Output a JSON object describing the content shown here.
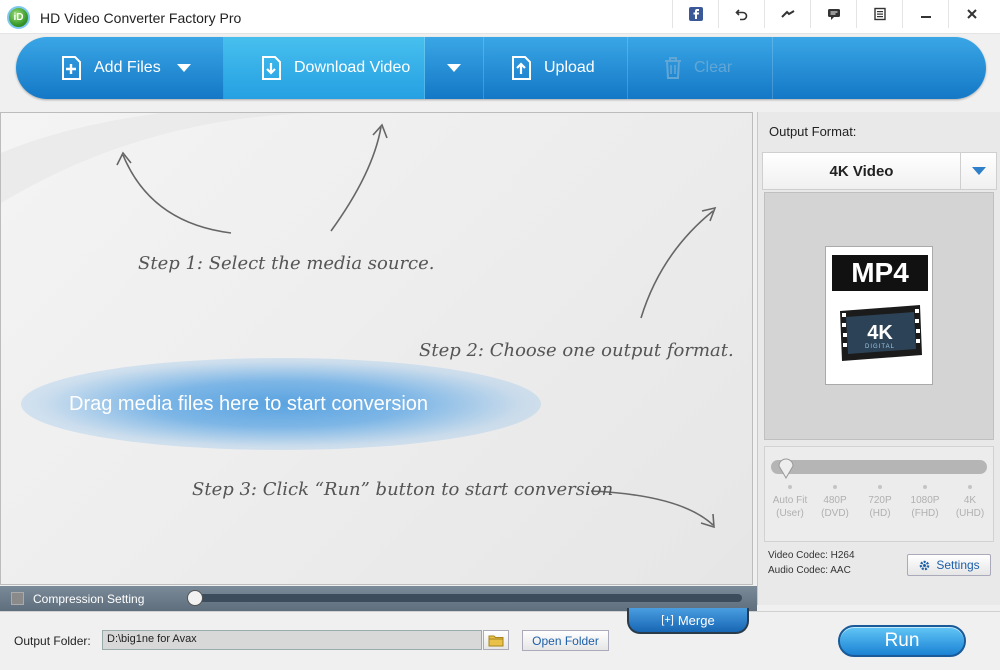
{
  "app": {
    "logo_text": "iD",
    "title": "HD Video Converter Factory Pro",
    "title_icons": [
      "facebook-icon",
      "undo-icon",
      "tools-icon",
      "chat-icon",
      "menu-icon",
      "minimize-icon",
      "close-icon"
    ]
  },
  "toolbar": {
    "add_files": "Add Files",
    "download_video": "Download Video",
    "upload": "Upload",
    "clear": "Clear",
    "accent_color": "#1e8fd8"
  },
  "workspace": {
    "step1": "Step 1: Select the media source.",
    "step2": "Step 2: Choose one output format.",
    "step3": "Step 3: Click “Run” button to start conversion",
    "drag_hint": "Drag media files here to start conversion"
  },
  "output": {
    "label": "Output Format:",
    "selected": "4K Video",
    "badge": "MP4",
    "badge_sub": "4K",
    "badge_sub2": "DIGITAL",
    "quality_value": 0,
    "quality_levels": [
      {
        "name": "Auto Fit",
        "sub": "(User)"
      },
      {
        "name": "480P",
        "sub": "(DVD)"
      },
      {
        "name": "720P",
        "sub": "(HD)"
      },
      {
        "name": "1080P",
        "sub": "(FHD)"
      },
      {
        "name": "4K",
        "sub": "(UHD)"
      }
    ],
    "video_codec": "Video Codec: H264",
    "audio_codec": "Audio Codec: AAC",
    "settings": "Settings"
  },
  "compression": {
    "label": "Compression Setting",
    "checked": false,
    "value": 0
  },
  "merge": {
    "icon_text": "[+]",
    "label": "Merge"
  },
  "bottom": {
    "output_folder_label": "Output Folder:",
    "output_folder_path": "D:\\big1ne for Avax",
    "open_folder": "Open Folder",
    "run": "Run"
  }
}
